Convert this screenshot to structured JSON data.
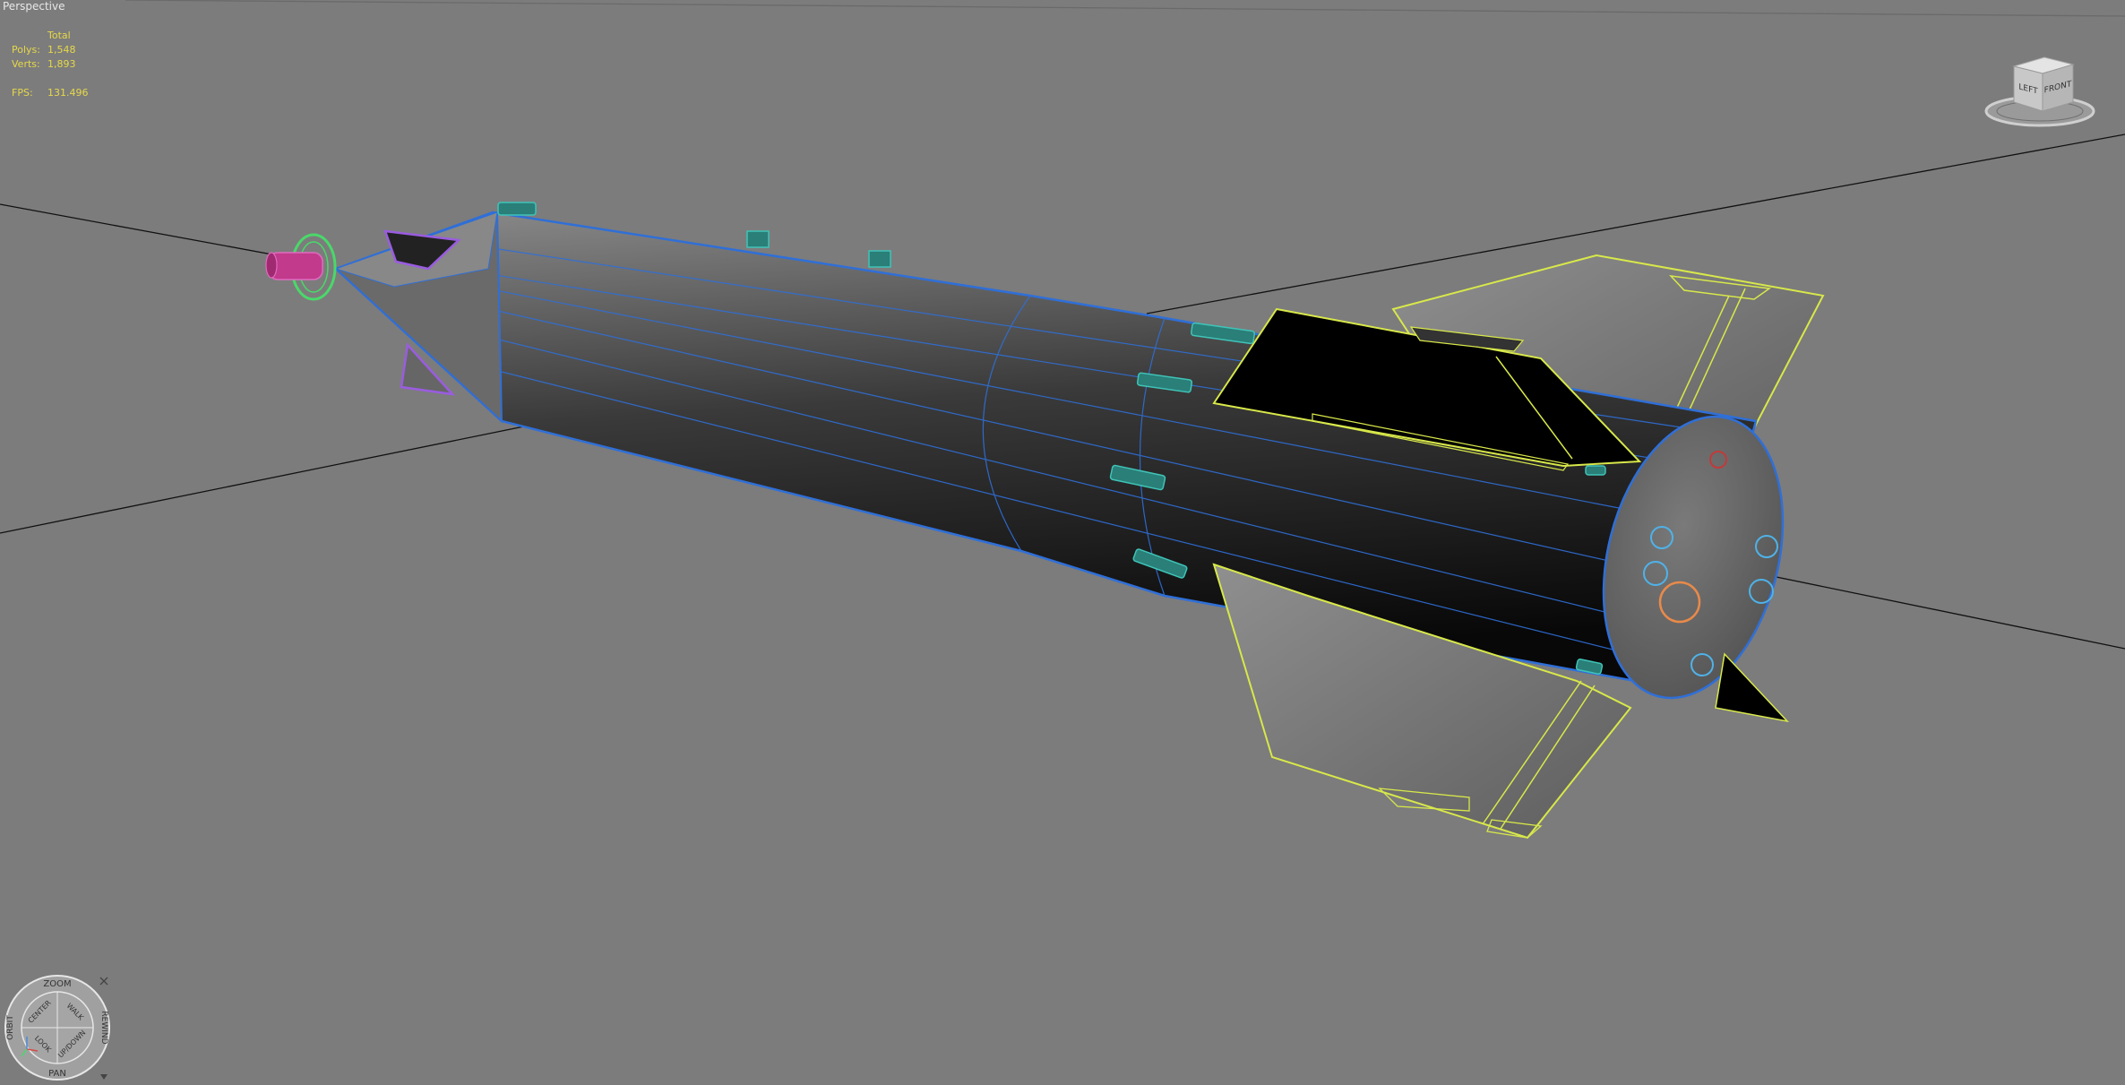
{
  "viewport": {
    "label": "Perspective"
  },
  "stats": {
    "header": "Total",
    "polys_label": "Polys:",
    "polys_value": "1,548",
    "verts_label": "Verts:",
    "verts_value": "1,893",
    "fps_label": "FPS:",
    "fps_value": "131.496"
  },
  "viewcube": {
    "left_face": "LEFT",
    "front_face": "FRONT"
  },
  "steering_wheel": {
    "zoom": "ZOOM",
    "orbit": "ORBIT",
    "rewind": "REWIND",
    "pan": "PAN",
    "center": "CENTER",
    "walk": "WALK",
    "look": "LOOK",
    "up_down": "UP/DOWN"
  },
  "colors": {
    "background": "#7c7c7c",
    "stats_text": "#e6d84a",
    "edge_blue": "#2f6fd8",
    "fin_yellow": "#d8e84a",
    "teal_parts": "#2fa39a",
    "purple_parts": "#9a5ce0",
    "magenta_tip": "#c23a8c",
    "green_ring": "#4ad86a"
  }
}
